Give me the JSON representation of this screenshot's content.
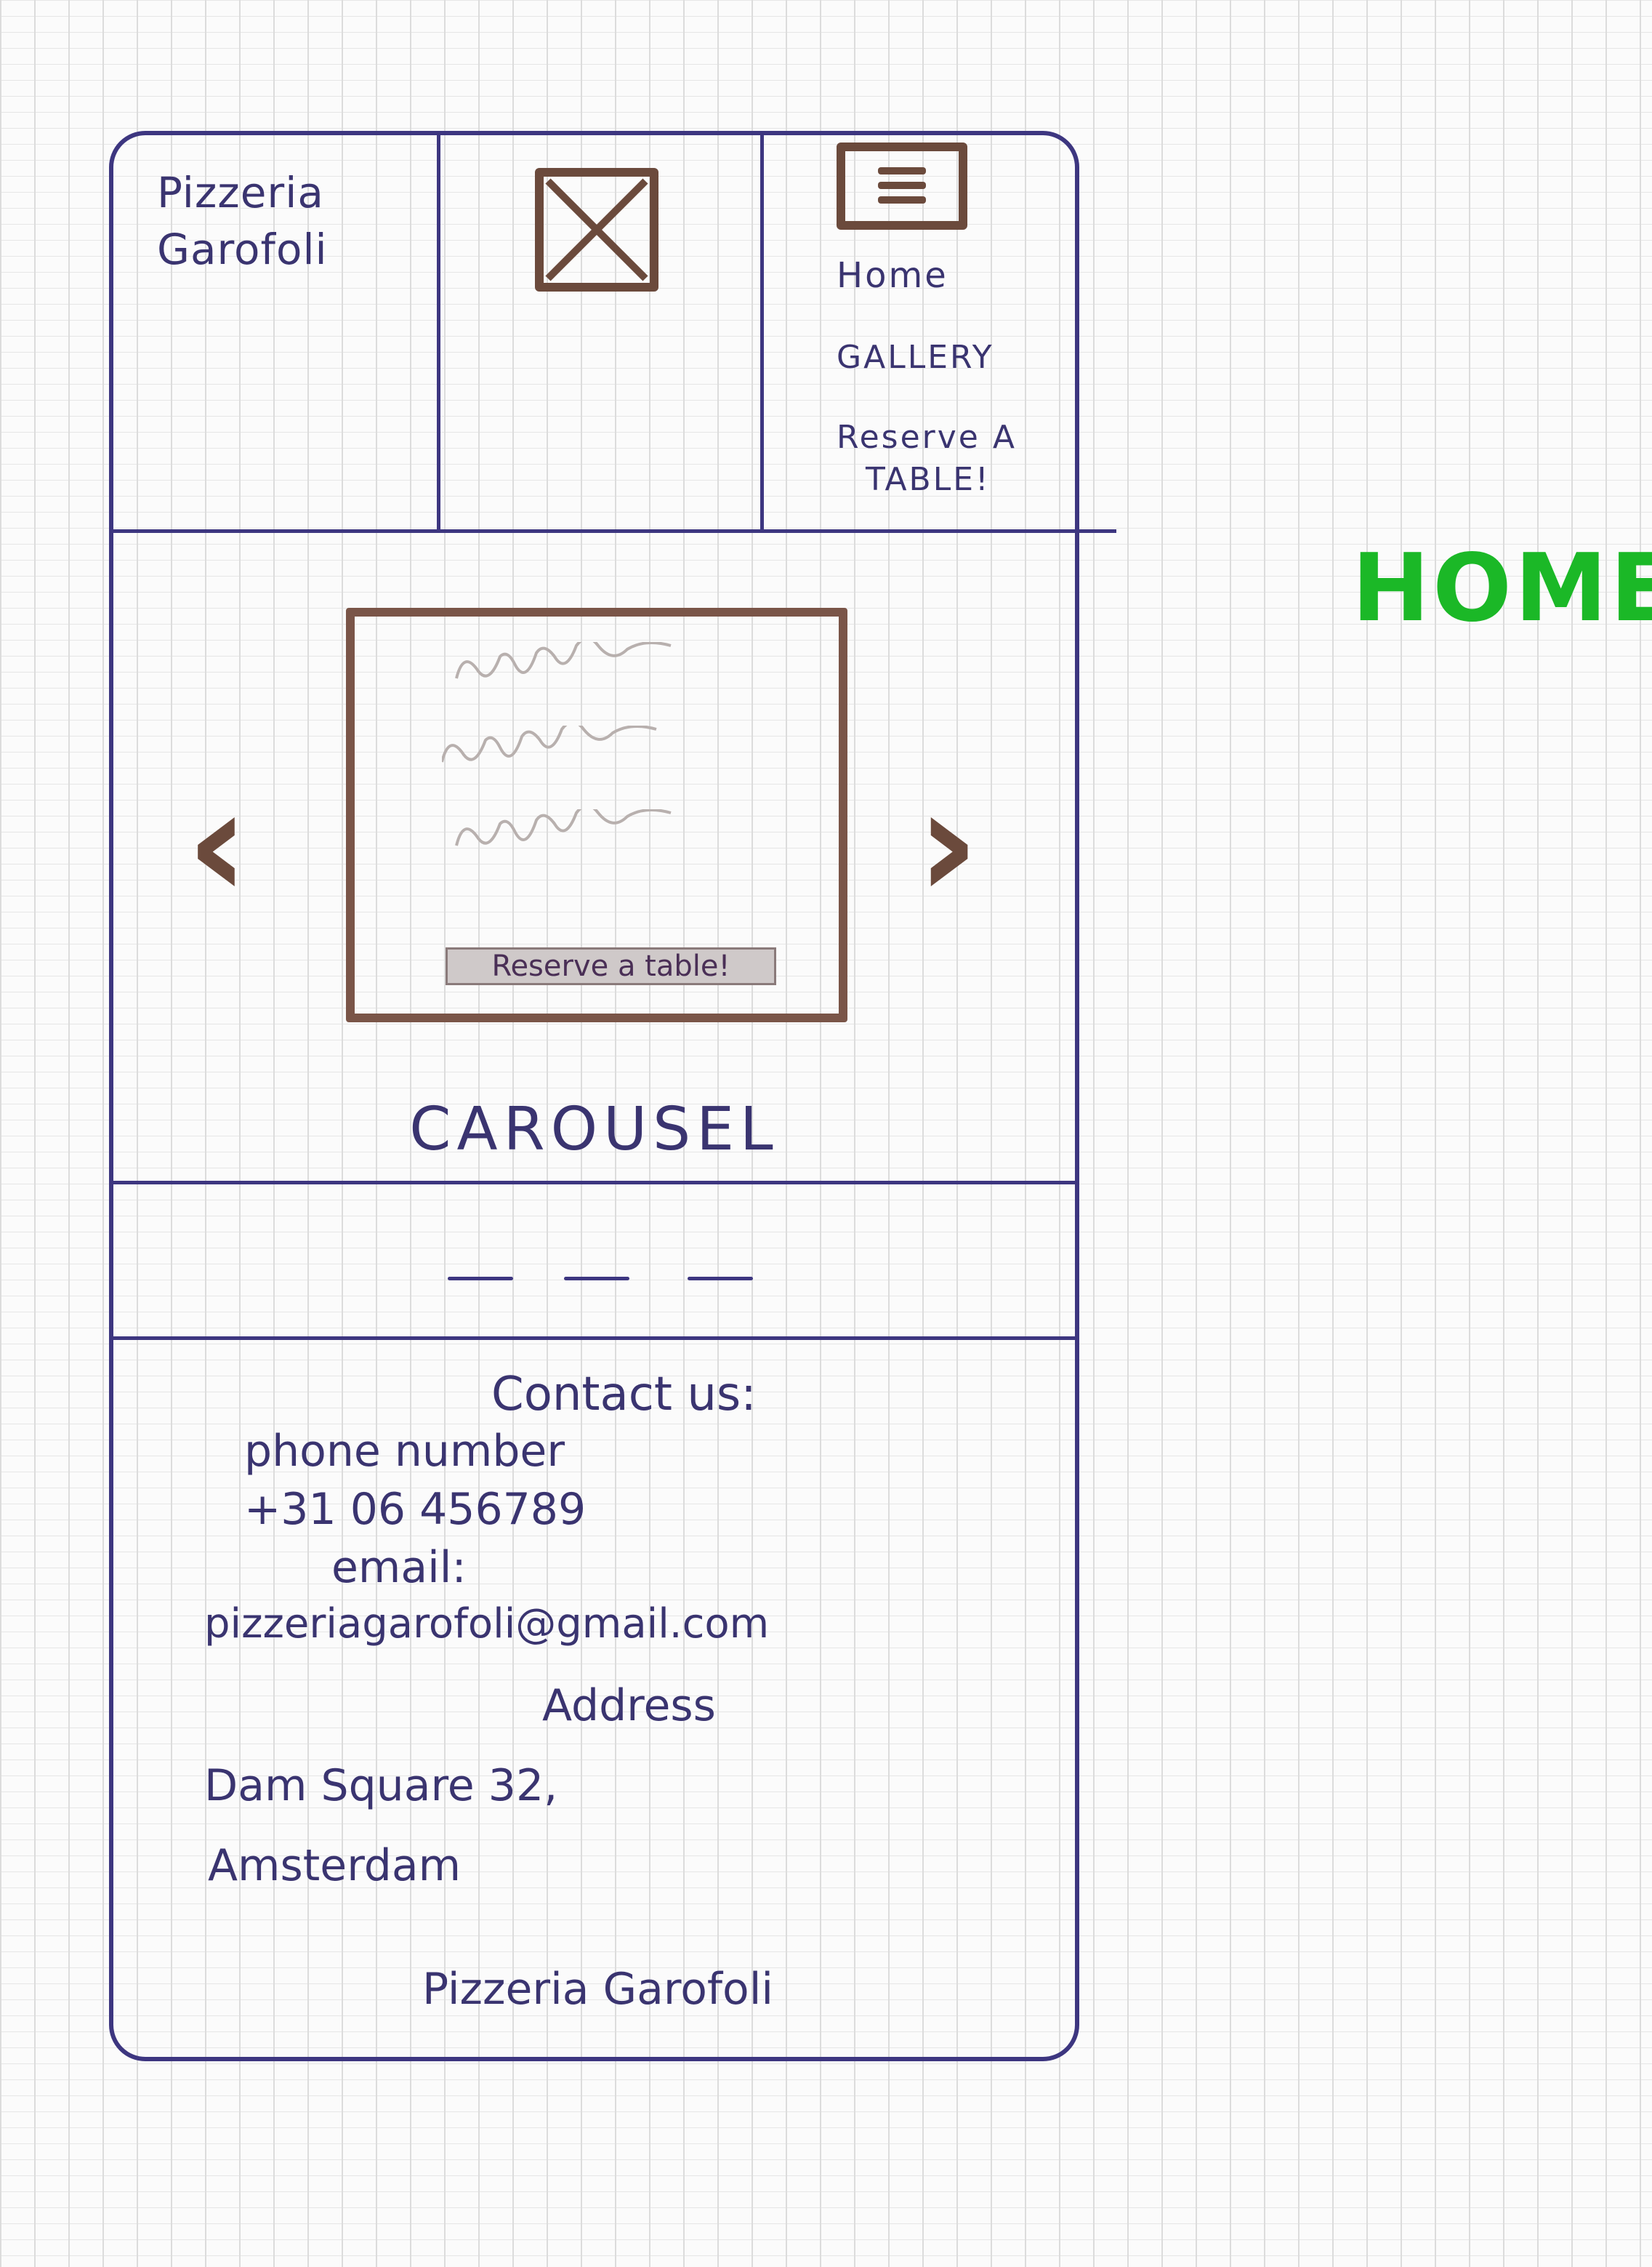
{
  "header": {
    "brand_line1": "Pizzeria",
    "brand_line2": "Garofoli",
    "logo_icon": "image-placeholder-icon",
    "menu_icon": "hamburger-menu-icon",
    "nav": [
      {
        "label": "Home"
      },
      {
        "label": "GALLERY"
      },
      {
        "label": "Reserve A"
      },
      {
        "label": "TABLE!"
      }
    ]
  },
  "carousel": {
    "prev_icon": "chevron-left-icon",
    "next_icon": "chevron-right-icon",
    "button_label": "Reserve a table!",
    "caption": "CAROUSEL"
  },
  "contact": {
    "heading": "Contact us:",
    "phone_label": "phone number",
    "phone_value": "+31 06 456789",
    "email_label": "email:",
    "email_value": "pizzeriagarofoli@gmail.com",
    "address_label": "Address",
    "address_line1": "Dam Square 32,",
    "address_line2": "Amsterdam"
  },
  "footer": {
    "brand": "Pizzeria Garofoli"
  },
  "page_label": "HOME",
  "colors": {
    "ink": "#3d3680",
    "sketch_brown": "#6b4a3c",
    "label_green": "#1bb827"
  }
}
